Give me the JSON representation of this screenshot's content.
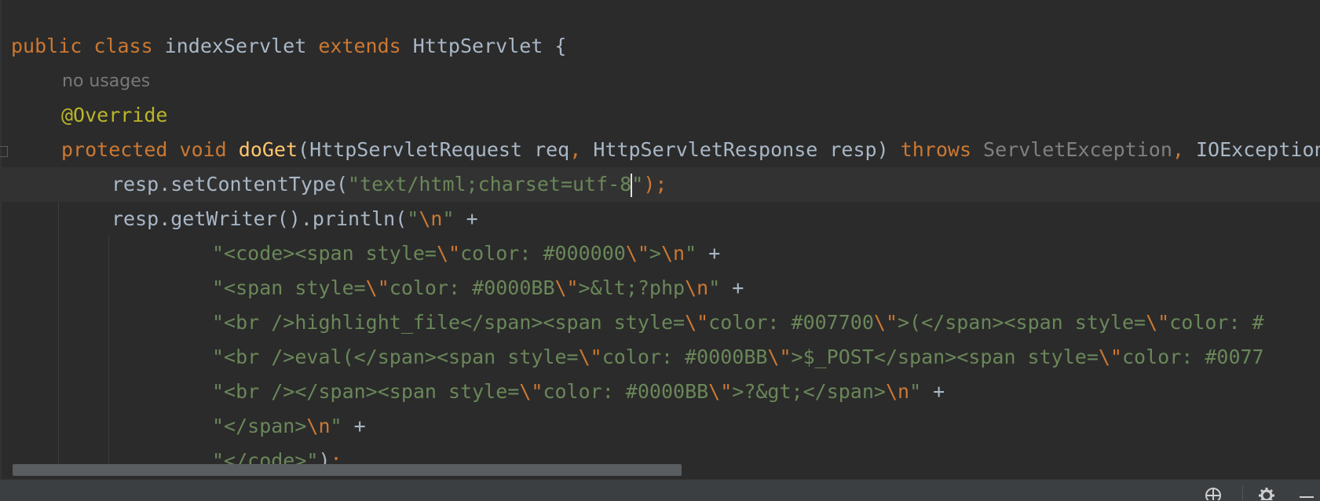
{
  "editor": {
    "inlay_hint": "no usages",
    "lines": [
      {
        "tokens": [
          {
            "t": "public ",
            "c": "kw"
          },
          {
            "t": "class ",
            "c": "kw"
          },
          {
            "t": "indexServlet ",
            "c": "plain"
          },
          {
            "t": "extends ",
            "c": "kw"
          },
          {
            "t": "HttpServlet {",
            "c": "plain"
          }
        ]
      },
      {
        "tokens": [
          {
            "t": "@Override",
            "c": "ann"
          }
        ]
      },
      {
        "tokens": [
          {
            "t": "protected ",
            "c": "kw"
          },
          {
            "t": "void ",
            "c": "kw"
          },
          {
            "t": "doGet",
            "c": "fn"
          },
          {
            "t": "(HttpServletRequest req",
            "c": "plain"
          },
          {
            "t": ", ",
            "c": "kw"
          },
          {
            "t": "HttpServletResponse resp) ",
            "c": "plain"
          },
          {
            "t": "throws ",
            "c": "kw"
          },
          {
            "t": "ServletException",
            "c": "dim"
          },
          {
            "t": ", ",
            "c": "kw"
          },
          {
            "t": "IOException {",
            "c": "plain"
          }
        ]
      },
      {
        "tokens": [
          {
            "t": "resp.setContentType(",
            "c": "plain"
          },
          {
            "t": "\"text/html;charset=utf-8",
            "c": "str"
          },
          {
            "t": "",
            "c": "caret"
          },
          {
            "t": "\"",
            "c": "str"
          },
          {
            "t": ");",
            "c": "kw"
          }
        ]
      },
      {
        "tokens": [
          {
            "t": "resp.getWriter().println(",
            "c": "plain"
          },
          {
            "t": "\"",
            "c": "str"
          },
          {
            "t": "\\n",
            "c": "esc"
          },
          {
            "t": "\" ",
            "c": "str"
          },
          {
            "t": "+",
            "c": "plain"
          }
        ]
      },
      {
        "tokens": [
          {
            "t": "\"<code><span style=",
            "c": "str"
          },
          {
            "t": "\\\"",
            "c": "esc"
          },
          {
            "t": "color: #000000",
            "c": "str"
          },
          {
            "t": "\\\"",
            "c": "esc"
          },
          {
            "t": ">",
            "c": "str"
          },
          {
            "t": "\\n",
            "c": "esc"
          },
          {
            "t": "\" ",
            "c": "str"
          },
          {
            "t": "+",
            "c": "plain"
          }
        ]
      },
      {
        "tokens": [
          {
            "t": "\"<span style=",
            "c": "str"
          },
          {
            "t": "\\\"",
            "c": "esc"
          },
          {
            "t": "color: #0000BB",
            "c": "str"
          },
          {
            "t": "\\\"",
            "c": "esc"
          },
          {
            "t": ">&lt;?php",
            "c": "str"
          },
          {
            "t": "\\n",
            "c": "esc"
          },
          {
            "t": "\" ",
            "c": "str"
          },
          {
            "t": "+",
            "c": "plain"
          }
        ]
      },
      {
        "tokens": [
          {
            "t": "\"<br />highlight_file</span><span style=",
            "c": "str"
          },
          {
            "t": "\\\"",
            "c": "esc"
          },
          {
            "t": "color: #007700",
            "c": "str"
          },
          {
            "t": "\\\"",
            "c": "esc"
          },
          {
            "t": ">(</span><span style=",
            "c": "str"
          },
          {
            "t": "\\\"",
            "c": "esc"
          },
          {
            "t": "color: #",
            "c": "str"
          }
        ]
      },
      {
        "tokens": [
          {
            "t": "\"<br />eval(</span><span style=",
            "c": "str"
          },
          {
            "t": "\\\"",
            "c": "esc"
          },
          {
            "t": "color: #0000BB",
            "c": "str"
          },
          {
            "t": "\\\"",
            "c": "esc"
          },
          {
            "t": ">$_POST</span><span style=",
            "c": "str"
          },
          {
            "t": "\\\"",
            "c": "esc"
          },
          {
            "t": "color: #0077",
            "c": "str"
          }
        ]
      },
      {
        "tokens": [
          {
            "t": "\"<br /></span><span style=",
            "c": "str"
          },
          {
            "t": "\\\"",
            "c": "esc"
          },
          {
            "t": "color: #0000BB",
            "c": "str"
          },
          {
            "t": "\\\"",
            "c": "esc"
          },
          {
            "t": ">?&gt;</span>",
            "c": "str"
          },
          {
            "t": "\\n",
            "c": "esc"
          },
          {
            "t": "\" ",
            "c": "str"
          },
          {
            "t": "+",
            "c": "plain"
          }
        ]
      },
      {
        "tokens": [
          {
            "t": "\"</span>",
            "c": "str"
          },
          {
            "t": "\\n",
            "c": "esc"
          },
          {
            "t": "\" ",
            "c": "str"
          },
          {
            "t": "+",
            "c": "plain"
          }
        ]
      },
      {
        "tokens": [
          {
            "t": "\"</code>\"",
            "c": "str"
          },
          {
            "t": ")",
            "c": "plain"
          },
          {
            "t": ";",
            "c": "kw"
          }
        ]
      }
    ]
  },
  "status_bar": {
    "icons": [
      "inspections-icon",
      "settings-icon",
      "minimize-icon"
    ]
  },
  "colors": {
    "background": "#2b2b2b",
    "keyword": "#cc7832",
    "string": "#6a8759",
    "annotation": "#bbb529",
    "method": "#ffc66d",
    "text": "#a9b7c6"
  }
}
